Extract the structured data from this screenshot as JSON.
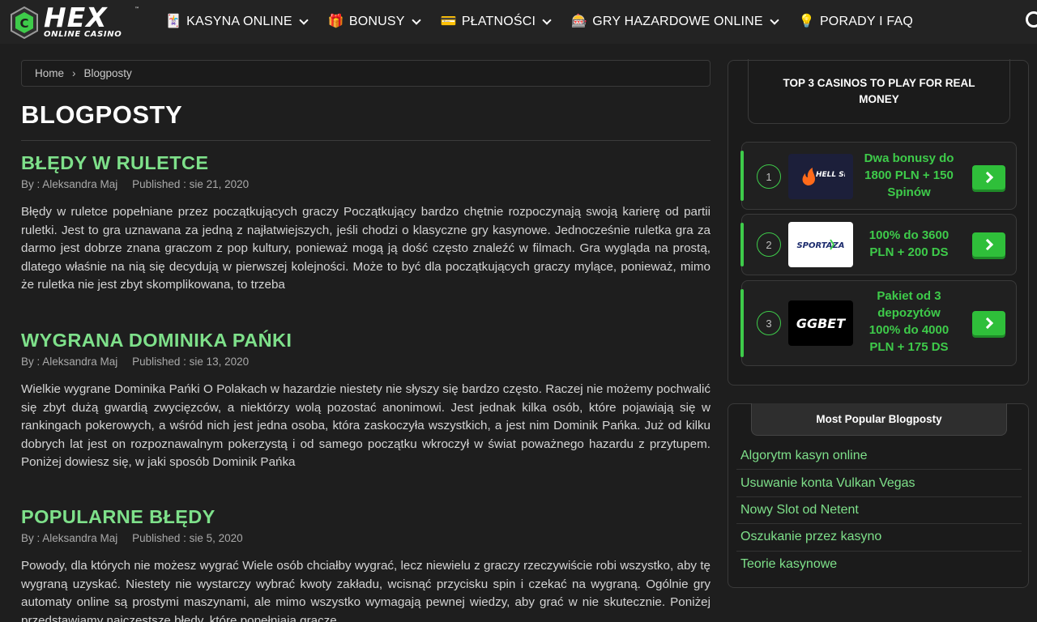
{
  "header": {
    "logo": {
      "main": "HEX",
      "tm": "™",
      "sub": "ONLINE CASINO"
    },
    "nav": [
      {
        "icon": "🃏",
        "icon_name": "cards-icon",
        "label": "KASYNA ONLINE",
        "has_dropdown": true
      },
      {
        "icon": "🎁",
        "icon_name": "gift-icon",
        "label": "BONUSY",
        "has_dropdown": true
      },
      {
        "icon": "💳",
        "icon_name": "credit-card-icon",
        "label": "PŁATNOŚCI",
        "has_dropdown": true
      },
      {
        "icon": "🎰",
        "icon_name": "slot-machine-icon",
        "label": "GRY HAZARDOWE ONLINE",
        "has_dropdown": true
      },
      {
        "icon": "💡",
        "icon_name": "lightbulb-icon",
        "label": "PORADY I FAQ",
        "has_dropdown": false
      }
    ]
  },
  "breadcrumb": {
    "home": "Home",
    "sep": "›",
    "current": "Blogposty"
  },
  "page_title": "BLOGPOSTY",
  "posts": [
    {
      "title": "BŁĘDY W RULETCE",
      "author": "By : Aleksandra Maj",
      "published": "Published : sie 21, 2020",
      "excerpt": "Błędy w ruletce popełniane przez początkujących graczy Początkujący bardzo chętnie rozpoczynają swoją karierę od partii ruletki. Jest to gra uznawana za jedną z najłatwiejszych, jeśli chodzi o klasyczne gry kasynowe. Jednocześnie ruletka gra za darmo jest dobrze znana graczom z pop kultury, ponieważ mogą ją dość często znaleźć w filmach. Gra wygląda na prostą, dlatego właśnie na nią się decydują w pierwszej kolejności. Może to być dla początkujących graczy mylące, ponieważ, mimo że ruletka nie jest zbyt skomplikowana, to trzeba"
    },
    {
      "title": "WYGRANA DOMINIKA PAŃKI",
      "author": "By : Aleksandra Maj",
      "published": "Published : sie 13, 2020",
      "excerpt": "Wielkie wygrane Dominika Pańki O Polakach w hazardzie niestety nie słyszy się bardzo często. Raczej nie możemy pochwalić się zbyt dużą gwardią zwycięzców, a niektórzy wolą pozostać anonimowi. Jest jednak kilka osób, które pojawiają się w rankingach pokerowych, a wśród nich jest jedna osoba, która zaskoczyła wszystkich, a jest nim Dominik Pańka. Już od kilku dobrych lat jest on rozpoznawalnym pokerzystą i od samego początku wkroczył w świat poważnego hazardu z przytupem. Poniżej dowiesz się, w jaki sposób Dominik Pańka"
    },
    {
      "title": "POPULARNE BŁĘDY",
      "author": "By : Aleksandra Maj",
      "published": "Published : sie 5, 2020",
      "excerpt": "Powody, dla których nie możesz wygrać Wiele osób chciałby wygrać, lecz niewielu z graczy rzeczywiście robi wszystko, aby tę wygraną uzyskać. Niestety nie wystarczy wybrać kwoty zakładu, wcisnąć przycisku spin i czekać na wygraną. Ogólnie gry automaty online są prostymi maszynami, ale mimo wszystko wymagają pewnej wiedzy, aby grać w nie skutecznie. Poniżej przedstawiamy najczęstsze błędy, które popełniają gracze"
    }
  ],
  "top3": {
    "title": "TOP 3 CASINOS TO PLAY FOR REAL MONEY",
    "casinos": [
      {
        "rank": "1",
        "logo": "HELL SPIN",
        "logo_bg": "#1c1f3a",
        "bonus": "Dwa bonusy do 1800 PLN + 150 Spinów"
      },
      {
        "rank": "2",
        "logo": "SPORTAZA",
        "logo_bg": "#ffffff",
        "bonus": "100% do 3600 PLN + 200 DS"
      },
      {
        "rank": "3",
        "logo": "GGBET",
        "logo_bg": "#000000",
        "bonus": "Pakiet od 3 depozytów 100% do 4000 PLN + 175 DS"
      }
    ]
  },
  "popular": {
    "title": "Most Popular Blogposty",
    "items": [
      "Algorytm kasyn online",
      "Usuwanie konta Vulkan Vegas",
      "Nowy Slot od Netent",
      "Oszukanie przez kasyno",
      "Teorie kasynowe"
    ]
  },
  "colors": {
    "accent": "#7ee08a",
    "green": "#3ecb4a",
    "bg": "#1e1e1e",
    "header_bg": "#232323"
  }
}
